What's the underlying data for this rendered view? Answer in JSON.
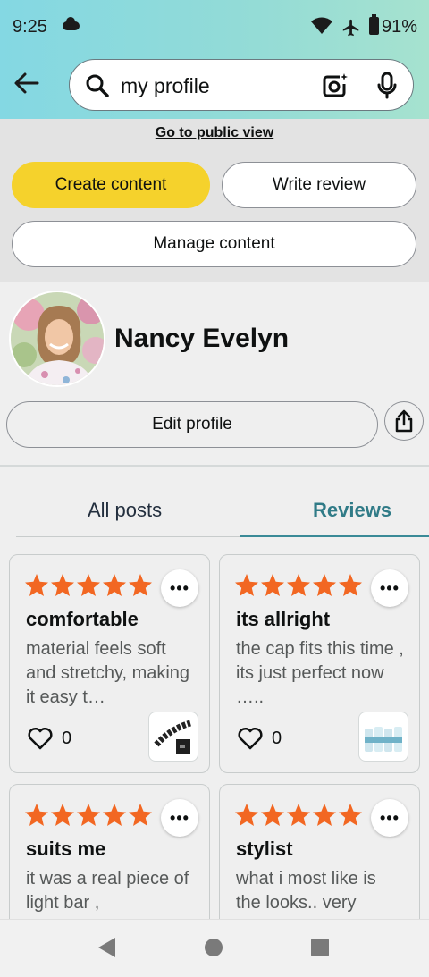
{
  "status_bar": {
    "time": "9:25",
    "battery": "91%"
  },
  "search": {
    "query": "my profile"
  },
  "public_view": {
    "label": "Go to public view"
  },
  "actions": {
    "create": "Create content",
    "write_review": "Write review",
    "manage": "Manage content"
  },
  "profile": {
    "name": "Nancy Evelyn",
    "edit_label": "Edit profile"
  },
  "tabs": {
    "all_posts": "All posts",
    "reviews": "Reviews",
    "active": "Reviews"
  },
  "reviews": [
    {
      "rating": 5,
      "title": "comfortable",
      "body": "material feels soft and stretchy, making it easy t…",
      "likes": "0"
    },
    {
      "rating": 5,
      "title": "its allright",
      "body": "the cap fits this time , its just perfect now …..",
      "likes": "0"
    },
    {
      "rating": 5,
      "title": "suits me",
      "body": "it was a real piece of light bar ,",
      "likes": ""
    },
    {
      "rating": 5,
      "title": "stylist",
      "body": "what i most like is the looks.. very",
      "likes": ""
    }
  ],
  "more_label": "•••",
  "colors": {
    "accent": "#f5d22c",
    "star": "#f26722",
    "tab_active": "#307b87"
  }
}
